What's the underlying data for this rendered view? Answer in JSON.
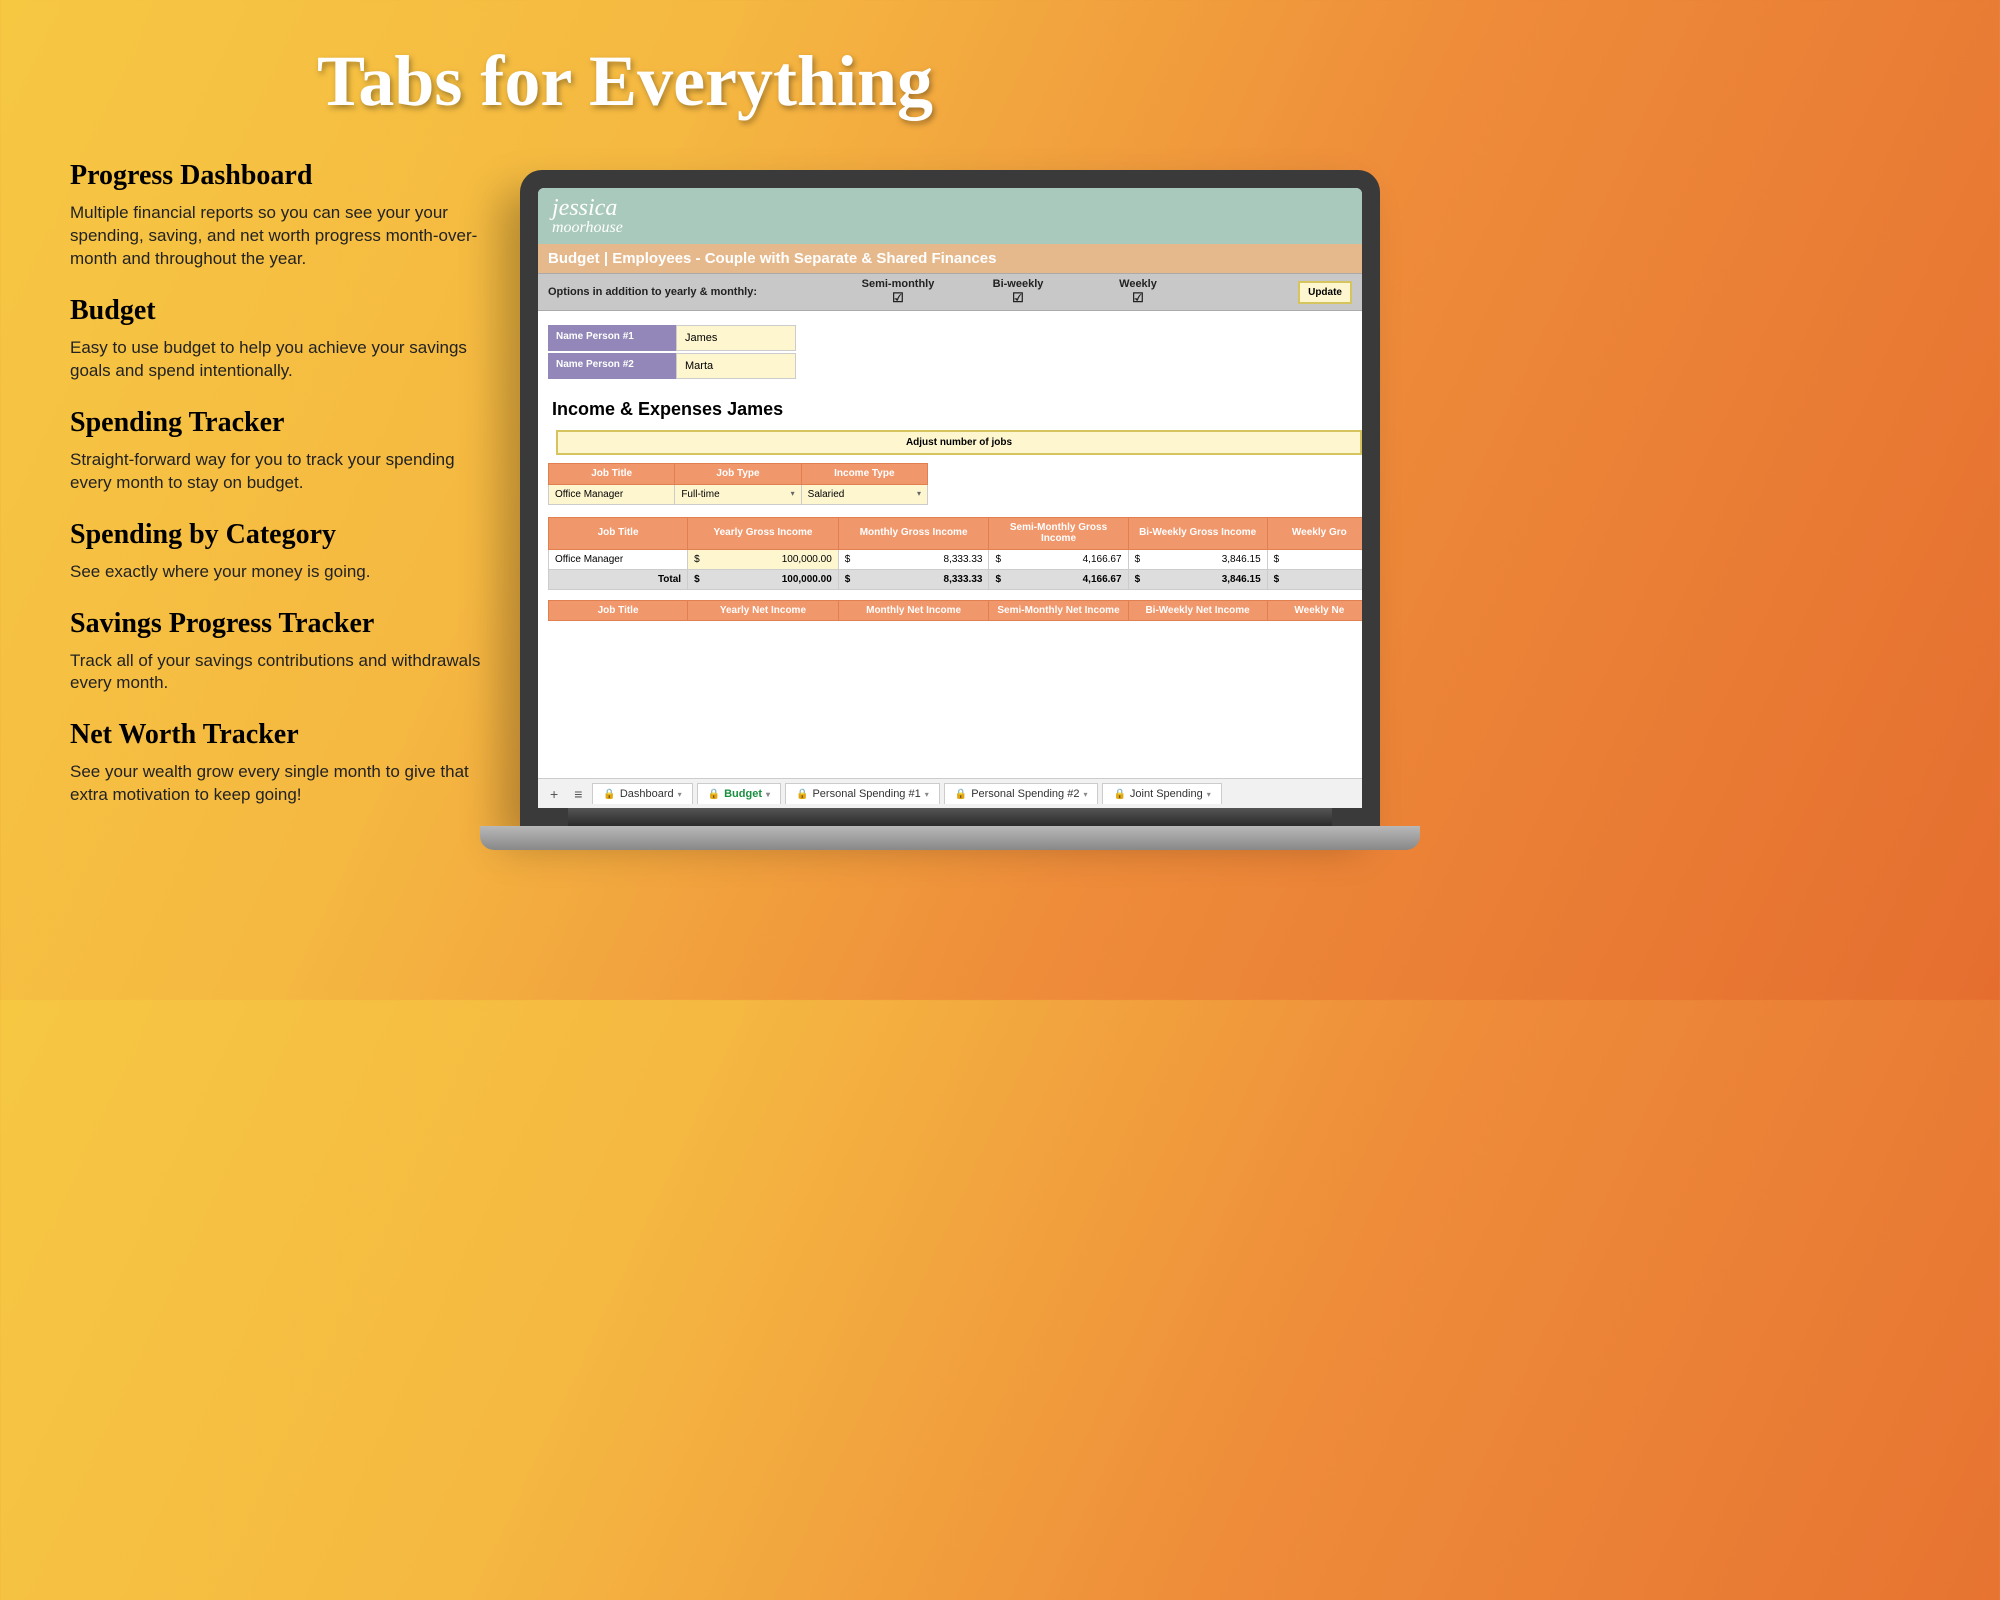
{
  "hero_title": "Tabs for Everything",
  "features": [
    {
      "title": "Progress Dashboard",
      "desc": "Multiple financial reports so you can see your your spending, saving, and net worth progress month-over-month and throughout the year."
    },
    {
      "title": "Budget",
      "desc": "Easy to use budget to help you achieve your savings goals and spend intentionally."
    },
    {
      "title": "Spending Tracker",
      "desc": "Straight-forward way for you to track your spending every month to stay on budget."
    },
    {
      "title": "Spending by Category",
      "desc": "See exactly where your money is going."
    },
    {
      "title": "Savings Progress Tracker",
      "desc": "Track all of your savings contributions and withdrawals every month."
    },
    {
      "title": "Net Worth Tracker",
      "desc": "See your wealth grow every single month to give that extra motivation to keep going!"
    }
  ],
  "brand": {
    "first": "jessica",
    "last": "moorhouse"
  },
  "sheet_title": "Budget | Employees - Couple with Separate & Shared Finances",
  "options": {
    "label": "Options in addition to yearly & monthly:",
    "cols": [
      "Semi-monthly",
      "Bi-weekly",
      "Weekly"
    ],
    "update": "Update"
  },
  "names": {
    "label1": "Name Person #1",
    "val1": "James",
    "label2": "Name Person #2",
    "val2": "Marta"
  },
  "section_title": "Income & Expenses James",
  "adjust_btn": "Adjust number of jobs",
  "job_headers": [
    "Job Title",
    "Job Type",
    "Income Type"
  ],
  "job_row": {
    "title": "Office Manager",
    "type": "Full-time",
    "income": "Salaried"
  },
  "gross_headers": [
    "Job Title",
    "Yearly Gross Income",
    "Monthly Gross Income",
    "Semi-Monthly Gross Income",
    "Bi-Weekly Gross Income",
    "Weekly Gro"
  ],
  "gross_row": {
    "title": "Office Manager",
    "yearly": "100,000.00",
    "monthly": "8,333.33",
    "semi": "4,166.67",
    "biweek": "3,846.15",
    "weekly": ""
  },
  "total_label": "Total",
  "net_headers": [
    "Job Title",
    "Yearly Net Income",
    "Monthly Net Income",
    "Semi-Monthly Net Income",
    "Bi-Weekly Net Income",
    "Weekly Ne"
  ],
  "tabs": {
    "items": [
      "Dashboard",
      "Budget",
      "Personal Spending #1",
      "Personal Spending #2",
      "Joint Spending"
    ],
    "active_index": 1
  }
}
